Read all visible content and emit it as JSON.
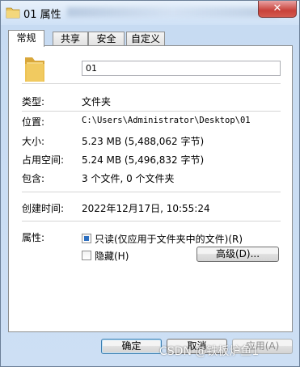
{
  "window": {
    "title": "01 属性"
  },
  "tabs": [
    {
      "label": "常规",
      "active": true
    },
    {
      "label": "共享",
      "active": false
    },
    {
      "label": "安全",
      "active": false
    },
    {
      "label": "自定义",
      "active": false
    }
  ],
  "general": {
    "name_value": "01",
    "type_label": "类型:",
    "type_value": "文件夹",
    "location_label": "位置:",
    "location_value": "C:\\Users\\Administrator\\Desktop\\01",
    "size_label": "大小:",
    "size_value": "5.23 MB (5,488,062 字节)",
    "size_on_disk_label": "占用空间:",
    "size_on_disk_value": "5.24 MB (5,496,832 字节)",
    "contains_label": "包含:",
    "contains_value": "3 个文件, 0 个文件夹",
    "created_label": "创建时间:",
    "created_value": "2022年12月17日, 10:55:24",
    "attributes_label": "属性:",
    "readonly_label": "只读(仅应用于文件夹中的文件)(R)",
    "readonly_state": "mixed",
    "hidden_label": "隐藏(H)",
    "hidden_checked": false,
    "advanced_button": "高级(D)..."
  },
  "footer": {
    "ok_button": "确定",
    "cancel_button": "取消",
    "apply_button": "应用(A)"
  },
  "watermark": "CSDN @铁板炉鱼1"
}
